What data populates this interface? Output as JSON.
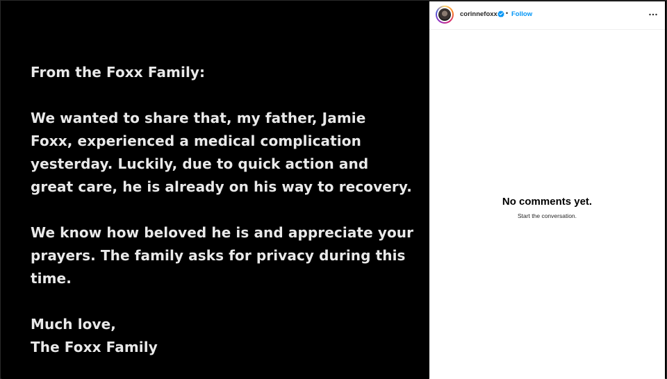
{
  "post": {
    "statement": [
      [
        "From the Foxx Family:"
      ],
      [
        "We wanted to share that, my father, Jamie",
        "Foxx, experienced a medical complication",
        "yesterday. Luckily, due to quick action and",
        "great care, he is already on his way to recovery."
      ],
      [
        "We know how beloved he is and appreciate your",
        "prayers. The family asks for privacy during this",
        "time."
      ],
      [
        "Much love,",
        "The Foxx Family"
      ]
    ]
  },
  "header": {
    "username": "corinnefoxx",
    "separator": "•",
    "follow_label": "Follow",
    "icons": {
      "verified": "verified-badge-icon",
      "more": "more-options-icon"
    }
  },
  "comments": {
    "empty_title": "No comments yet.",
    "empty_subtitle": "Start the conversation."
  },
  "colors": {
    "follow": "#0095f6",
    "verified": "#0095f6",
    "statement_text": "#e9e9e9",
    "media_background": "#000000"
  }
}
